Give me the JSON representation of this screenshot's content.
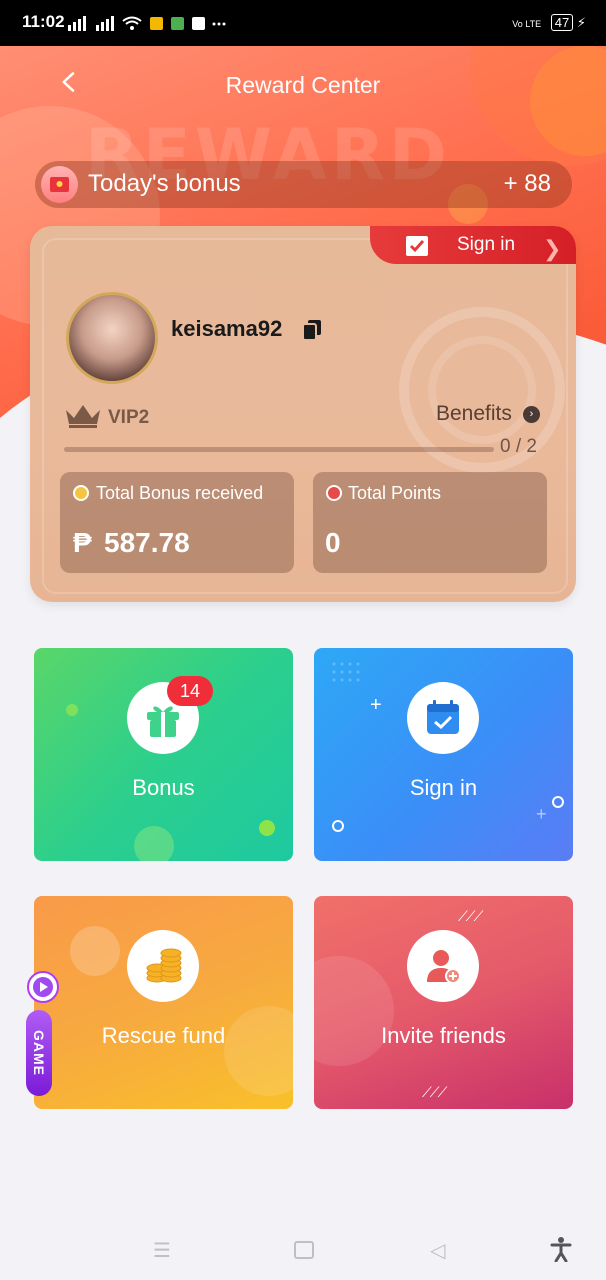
{
  "status_bar": {
    "time": "11:02",
    "network_label": "Vo LTE",
    "battery": "47"
  },
  "header": {
    "title": "Reward Center",
    "watermark": "REWARD"
  },
  "todays_bonus": {
    "label": "Today's bonus",
    "value": "+ 88"
  },
  "profile": {
    "sign_in_tab": "Sign in",
    "username": "keisama92",
    "vip_level": "VIP2",
    "benefits_label": "Benefits",
    "progress_text": "0 / 2",
    "progress_fraction": 0.0
  },
  "stats": {
    "total_bonus": {
      "label": "Total Bonus received",
      "currency": "₱",
      "value": "587.78"
    },
    "total_points": {
      "label": "Total Points",
      "value": "0"
    }
  },
  "tiles": {
    "bonus": {
      "label": "Bonus",
      "badge": "14"
    },
    "sign_in": {
      "label": "Sign in"
    },
    "rescue_fund": {
      "label": "Rescue fund"
    },
    "invite_friends": {
      "label": "Invite friends"
    }
  },
  "game_float": {
    "label": "GAME"
  },
  "colors": {
    "accent": "#f75a35",
    "sign_tab": "#d51f27",
    "badge": "#f02e3a",
    "bonus_tile": "#2bcf8e",
    "sign_tile": "#3aa3f5",
    "rescue_tile": "#f7a53e",
    "invite_tile": "#e0506a"
  },
  "icons": {
    "back": "chevron-left-icon",
    "copy": "copy-icon",
    "crown": "crown-icon",
    "gift": "gift-icon",
    "calendar": "calendar-check-icon",
    "coins": "coins-icon",
    "invite": "add-user-icon"
  }
}
